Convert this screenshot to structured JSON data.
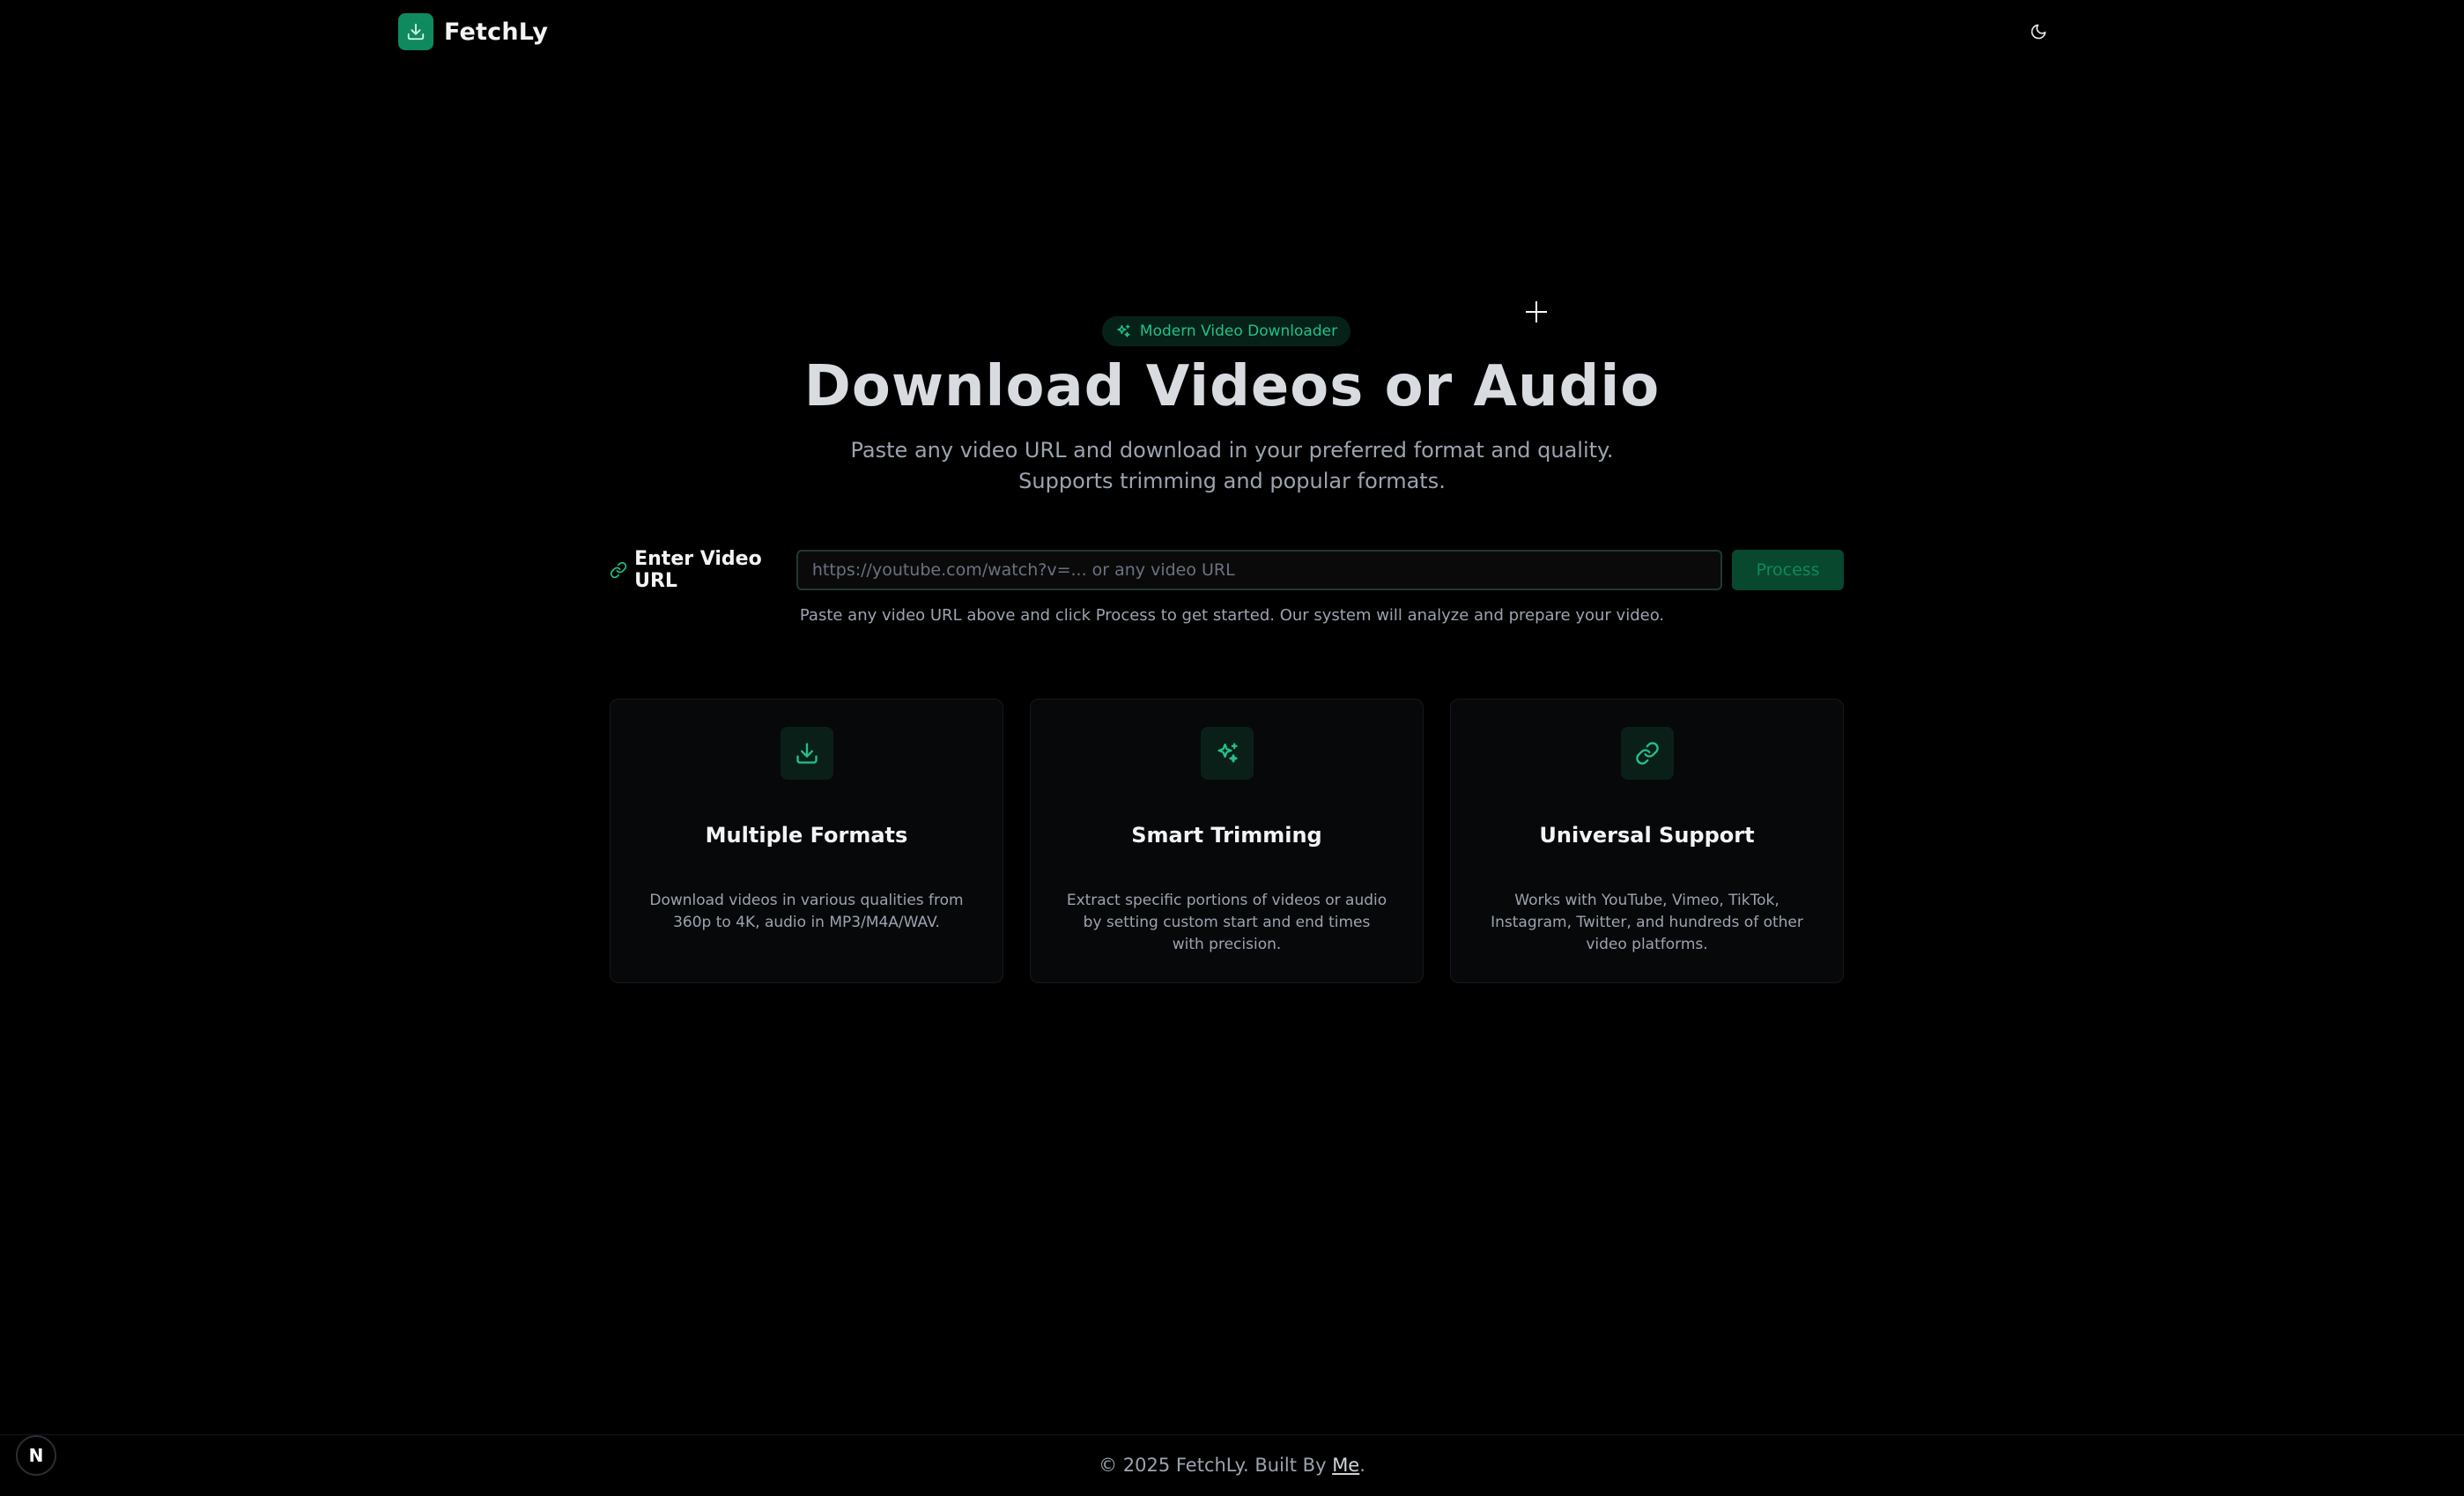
{
  "brand": {
    "name": "FetchLy",
    "icon": "download-icon"
  },
  "header": {
    "theme_toggle_icon": "moon-icon"
  },
  "hero": {
    "badge_icon": "sparkles-icon",
    "badge": "Modern Video Downloader",
    "title": "Download Videos or Audio",
    "subtitle_line1": "Paste any video URL and download in your preferred format and quality.",
    "subtitle_line2": "Supports trimming and popular formats."
  },
  "url_form": {
    "label_icon": "link-icon",
    "label": "Enter Video URL",
    "value": "",
    "placeholder": "https://youtube.com/watch?v=... or any video URL",
    "button": "Process",
    "hint": "Paste any video URL above and click Process to get started. Our system will analyze and prepare your video."
  },
  "features": [
    {
      "icon": "download-icon",
      "title": "Multiple Formats",
      "description": "Download videos in various qualities from 360p to 4K, audio in MP3/M4A/WAV."
    },
    {
      "icon": "sparkles-icon",
      "title": "Smart Trimming",
      "description": "Extract specific portions of videos or audio by setting custom start and end times with precision."
    },
    {
      "icon": "link-icon",
      "title": "Universal Support",
      "description": "Works with YouTube, Vimeo, TikTok, Instagram, Twitter, and hundreds of other video platforms."
    }
  ],
  "footer": {
    "text": "© 2025 FetchLy. Built By",
    "link": "Me",
    "suffix": "."
  },
  "dev_badge": {
    "label": "N"
  },
  "colors": {
    "accent": "#0f8a5f",
    "accent_text": "#22c08a",
    "background": "#000000",
    "card": "#07080a"
  }
}
